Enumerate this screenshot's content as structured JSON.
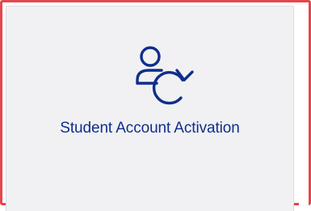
{
  "tile": {
    "title": "Student Account Activation",
    "icon": "user-refresh-icon"
  },
  "colors": {
    "accent": "#0f2e8c",
    "card_background": "#f1f1f3",
    "highlight_border": "#e8454b"
  }
}
